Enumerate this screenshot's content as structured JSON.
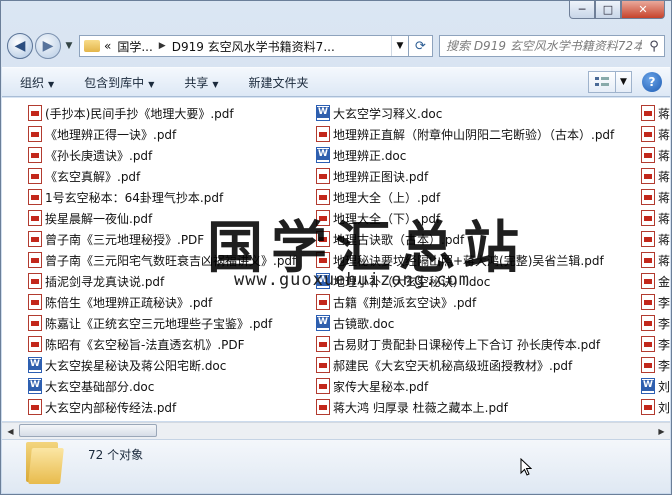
{
  "window": {
    "min_glyph": "─",
    "max_glyph": "□",
    "close_glyph": "✕"
  },
  "nav": {
    "back_glyph": "◀",
    "forward_glyph": "▶",
    "crumb_lead": "«",
    "crumbs": [
      "国学...",
      "D919 玄空风水学书籍资料7..."
    ],
    "refresh_glyph": "⟳",
    "search_placeholder": "搜索 D919 玄空风水学书籍资料72本"
  },
  "toolbar": {
    "organize": "组织",
    "include_in_library": "包含到库中",
    "share": "共享",
    "new_folder": "新建文件夹"
  },
  "watermark": {
    "title": "国学汇总站",
    "url": "www.guoxuehuizong.com"
  },
  "files": {
    "col1": [
      {
        "name": "(手抄本)民间手抄《地理大要》.pdf",
        "type": "pdf"
      },
      {
        "name": "《地理辨正得一诀》.pdf",
        "type": "pdf"
      },
      {
        "name": "《孙长庚遗诀》.pdf",
        "type": "pdf"
      },
      {
        "name": "《玄空真解》.pdf",
        "type": "pdf"
      },
      {
        "name": "1号玄空秘本：64卦理气抄本.pdf",
        "type": "pdf"
      },
      {
        "name": "挨星晨解一夜仙.pdf",
        "type": "pdf"
      },
      {
        "name": "曾子南《三元地理秘授》.PDF",
        "type": "pdf"
      },
      {
        "name": "曾子南《三元阳宅气数旺衰吉凶祸福讲义》.pdf",
        "type": "pdf"
      },
      {
        "name": "插泥剑寻龙真诀说.pdf",
        "type": "pdf"
      },
      {
        "name": "陈倍生《地理辨正疏秘诀》.pdf",
        "type": "pdf"
      },
      {
        "name": "陈嘉让《正统玄空三元地理些子宝鉴》.pdf",
        "type": "pdf"
      },
      {
        "name": "陈昭有《玄空秘旨-法直透玄机》.PDF",
        "type": "pdf"
      },
      {
        "name": "大玄空挨星秘诀及蒋公阳宅断.doc",
        "type": "doc"
      },
      {
        "name": "大玄空基础部分.doc",
        "type": "doc"
      },
      {
        "name": "大玄空内部秘传经法.pdf",
        "type": "pdf"
      }
    ],
    "col2": [
      {
        "name": "大玄空学习释义.doc",
        "type": "doc"
      },
      {
        "name": "地理辨正直解（附章仲山阴阳二宅断验）（古本）.pdf",
        "type": "pdf"
      },
      {
        "name": "地理辨正.doc",
        "type": "doc"
      },
      {
        "name": "地理辨正图诀.pdf",
        "type": "pdf"
      },
      {
        "name": "地理大全（上）.pdf",
        "type": "pdf"
      },
      {
        "name": "地理大全（下）.pdf",
        "type": "pdf"
      },
      {
        "name": "地理古诀歌（古本）.pdf",
        "type": "pdf"
      },
      {
        "name": "地理秘诀要坟经隔山照+蒋大鸿(完整)吴省兰辑.pdf",
        "type": "pdf"
      },
      {
        "name": "地理小补（大玄空秘诀）.doc",
        "type": "doc"
      },
      {
        "name": "古籍《荆楚派玄空诀》.pdf",
        "type": "pdf"
      },
      {
        "name": "古镜歌.doc",
        "type": "doc"
      },
      {
        "name": "古易财丁贵配卦日课秘传上下合订 孙长庚传本.pdf",
        "type": "pdf"
      },
      {
        "name": "郝建民《大玄空天机秘高级班函授教材》.pdf",
        "type": "pdf"
      },
      {
        "name": "家传大星秘本.pdf",
        "type": "pdf"
      },
      {
        "name": "蒋大鸿 归厚录 杜薇之藏本上.pdf",
        "type": "pdf"
      }
    ],
    "col3": [
      {
        "name": "蒋大鸿",
        "type": "pdf"
      },
      {
        "name": "蒋大鸿",
        "type": "pdf"
      },
      {
        "name": "蒋大鸿",
        "type": "pdf"
      },
      {
        "name": "蒋大鸿",
        "type": "pdf"
      },
      {
        "name": "蒋大鸿",
        "type": "pdf"
      },
      {
        "name": "蒋大鸿",
        "type": "pdf"
      },
      {
        "name": "蒋大鸿",
        "type": "pdf"
      },
      {
        "name": "蒋大鸿",
        "type": "pdf"
      },
      {
        "name": "金锁玉",
        "type": "pdf"
      },
      {
        "name": "李崇仰",
        "type": "pdf"
      },
      {
        "name": "李崇仰",
        "type": "pdf"
      },
      {
        "name": "李明",
        "type": "pdf"
      },
      {
        "name": "李明",
        "type": "pdf"
      },
      {
        "name": "刘孝",
        "type": "doc"
      },
      {
        "name": "刘孝",
        "type": "pdf"
      }
    ]
  },
  "status": {
    "count_text": "72 个对象"
  }
}
